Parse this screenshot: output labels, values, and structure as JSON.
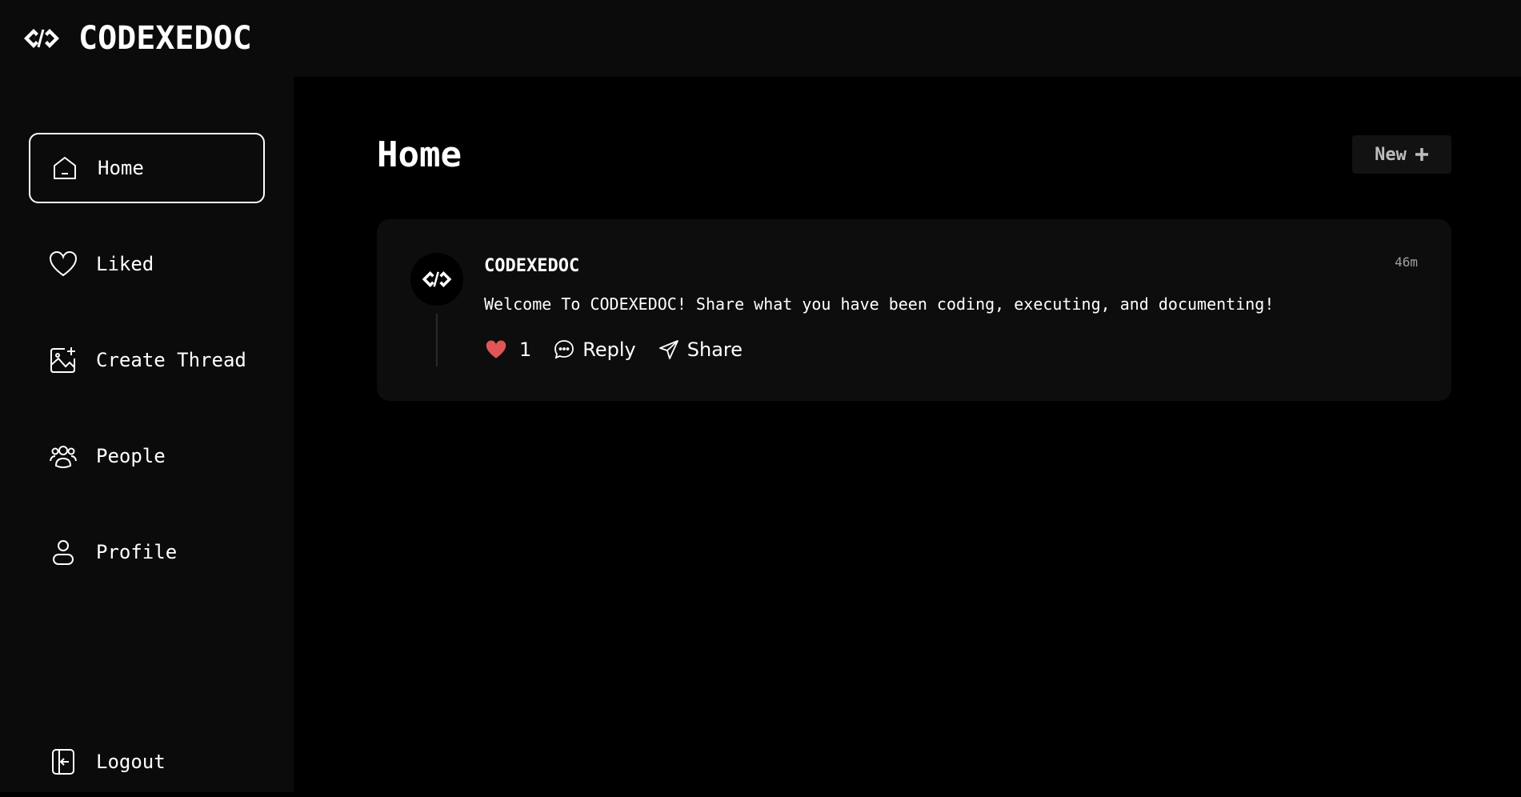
{
  "app": {
    "brand": "CODEXEDOC"
  },
  "sidebar": {
    "items": [
      {
        "label": "Home",
        "icon": "home-icon",
        "active": true
      },
      {
        "label": "Liked",
        "icon": "heart-icon",
        "active": false
      },
      {
        "label": "Create Thread",
        "icon": "image-plus-icon",
        "active": false
      },
      {
        "label": "People",
        "icon": "people-icon",
        "active": false
      },
      {
        "label": "Profile",
        "icon": "user-icon",
        "active": false
      }
    ],
    "logout": {
      "label": "Logout",
      "icon": "logout-icon"
    }
  },
  "main": {
    "title": "Home",
    "new_button": {
      "label": "New",
      "icon": "plus-icon"
    }
  },
  "thread": {
    "author": "CODEXEDOC",
    "time": "46m",
    "content": "Welcome To CODEXEDOC! Share what you have been coding, executing, and documenting!",
    "likes": "1",
    "reply_label": "Reply",
    "share_label": "Share"
  },
  "colors": {
    "background": "#000000",
    "panel": "#0b0b0b",
    "card": "#0d0d0d",
    "like": "#e05555",
    "text": "#ffffff"
  }
}
